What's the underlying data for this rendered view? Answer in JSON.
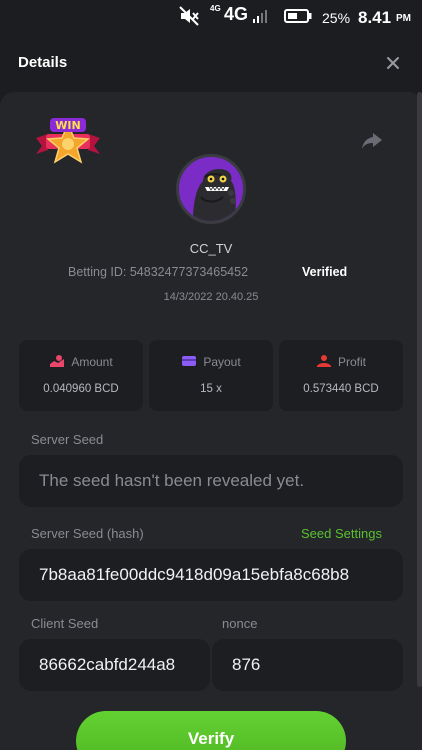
{
  "status_bar": {
    "net_type_small": "4G",
    "net_type": "4G",
    "battery_percent": "25%",
    "time": "8.41",
    "ampm": "PM"
  },
  "header": {
    "title": "Details"
  },
  "bet": {
    "username": "CC_TV",
    "betting_id": "Betting ID: 548324773734654​52",
    "verified_label": "Verified",
    "datetime": "14/3/2022 20.40.25"
  },
  "stats": [
    {
      "label": "Amount",
      "value": "0.040960 BCD",
      "icon": "amount-icon",
      "color": "#e8476b"
    },
    {
      "label": "Payout",
      "value": "15 x",
      "icon": "payout-icon",
      "color": "#8b5cf6"
    },
    {
      "label": "Profit",
      "value": "0.573440 BCD",
      "icon": "profit-icon",
      "color": "#e53935"
    }
  ],
  "server_seed": {
    "label": "Server Seed",
    "value": "The seed hasn't been revealed yet."
  },
  "server_seed_hash": {
    "label": "Server Seed (hash)",
    "settings_link": "Seed Settings",
    "value": "7b8aa81fe00ddc9418d09a15ebfa8c68b8"
  },
  "client_seed": {
    "label": "Client Seed",
    "value": "86662cabfd244a8"
  },
  "nonce": {
    "label": "nonce",
    "value": "876"
  },
  "actions": {
    "verify_label": "Verify"
  },
  "colors": {
    "accent_green": "#59c130",
    "panel": "#25262a",
    "field_bg": "#1d1e21"
  }
}
